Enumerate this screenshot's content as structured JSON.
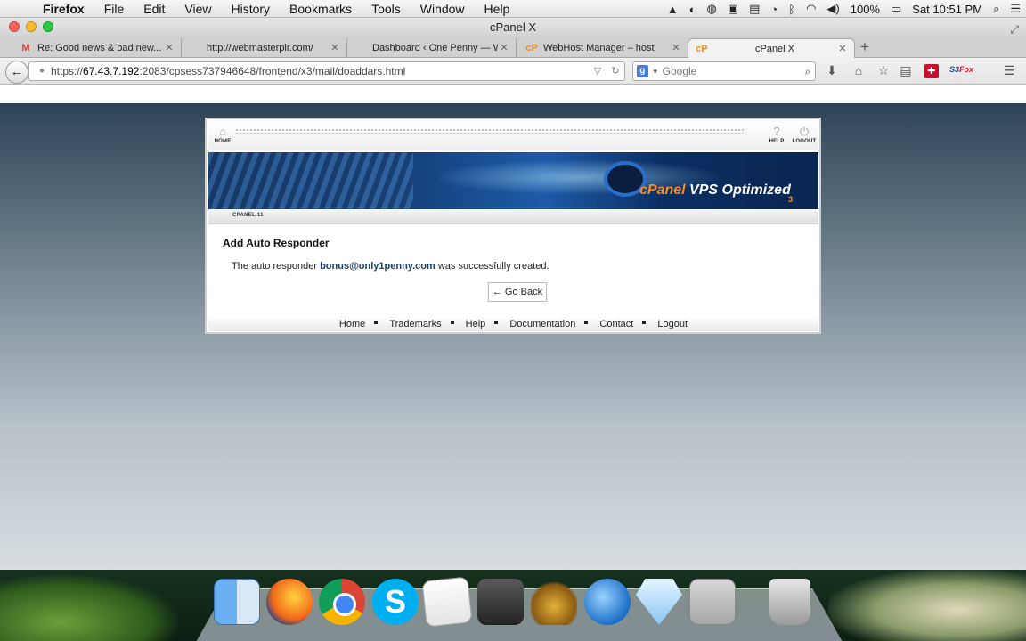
{
  "menubar": {
    "app": "Firefox",
    "items": [
      "File",
      "Edit",
      "View",
      "History",
      "Bookmarks",
      "Tools",
      "Window",
      "Help"
    ],
    "battery": "100%",
    "clock": "Sat 10:51 PM"
  },
  "window": {
    "title": "cPanel X"
  },
  "tabs": [
    {
      "icon": "M",
      "label": "Re: Good news & bad new...",
      "close": "✕"
    },
    {
      "icon": "",
      "label": "http://webmasterplr.com/",
      "close": "✕"
    },
    {
      "icon": "",
      "label": "Dashboard ‹ One Penny — Wo...",
      "close": "✕"
    },
    {
      "icon": "cP",
      "label": "WebHost Manager – host",
      "close": "✕"
    },
    {
      "icon": "cP",
      "label": "cPanel X",
      "close": "✕"
    }
  ],
  "navbar": {
    "url_prefix": "https://",
    "url_host": "67.43.7.192",
    "url_rest": ":2083/cpsess737946648/frontend/x3/mail/doaddars.html",
    "search_placeholder": "Google",
    "search_engine_icon": "g",
    "s3fox_a": "S3",
    "s3fox_b": "Fox"
  },
  "cpanel": {
    "nav_home": "HOME",
    "nav_help": "HELP",
    "nav_logout": "LOGOUT",
    "banner_brand": "cPanel",
    "banner_tagline": " VPS Optimized",
    "banner_version": "3",
    "version_label": "CPANEL 11",
    "heading": "Add Auto Responder",
    "message_before": "The auto responder ",
    "message_email": "bonus@only1penny.com",
    "message_after": " was successfully created.",
    "go_back": "← Go Back",
    "footer": [
      "Home",
      "Trademarks",
      "Help",
      "Documentation",
      "Contact",
      "Logout"
    ]
  },
  "dock": {
    "skype_glyph": "S"
  }
}
